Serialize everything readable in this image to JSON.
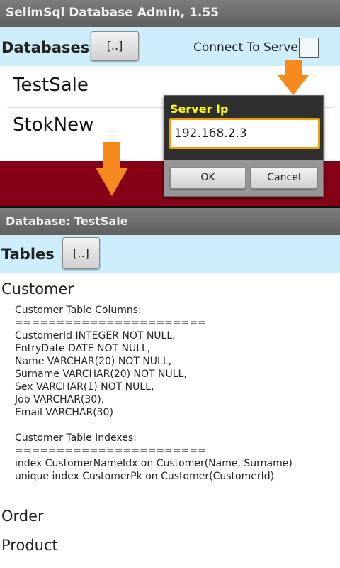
{
  "app": {
    "title": "SelimSql Database Admin, 1.55"
  },
  "databases": {
    "heading": "Databases",
    "up_button": "[..]",
    "connect_label": "Connect To Server",
    "items": [
      "TestSale",
      "StokNew"
    ]
  },
  "dialog": {
    "title": "Server Ip",
    "ip_value": "192.168.2.3",
    "ok_label": "OK",
    "cancel_label": "Cancel"
  },
  "database_screen": {
    "title": "Database: TestSale",
    "tables_heading": "Tables",
    "up_button": "[..]",
    "tables": [
      {
        "name": "Customer",
        "info": "Customer Table Columns:\n=======================\nCustomerId INTEGER NOT NULL,\nEntryDate DATE NOT NULL,\nName VARCHAR(20) NOT NULL,\nSurname VARCHAR(20) NOT NULL,\nSex VARCHAR(1) NOT NULL,\nJob VARCHAR(30),\nEmail VARCHAR(30)\n\nCustomer Table Indexes:\n=======================\nindex CustomerNameIdx on Customer(Name, Surname)\nunique index CustomerPk on Customer(CustomerId)"
      },
      {
        "name": "Order"
      },
      {
        "name": "Product"
      }
    ]
  },
  "colors": {
    "header_bg": "#cfeefc",
    "band": "#850016",
    "arrow": "#f78a1e",
    "dialog_title": "#ffff00",
    "input_border": "#f0a000"
  }
}
